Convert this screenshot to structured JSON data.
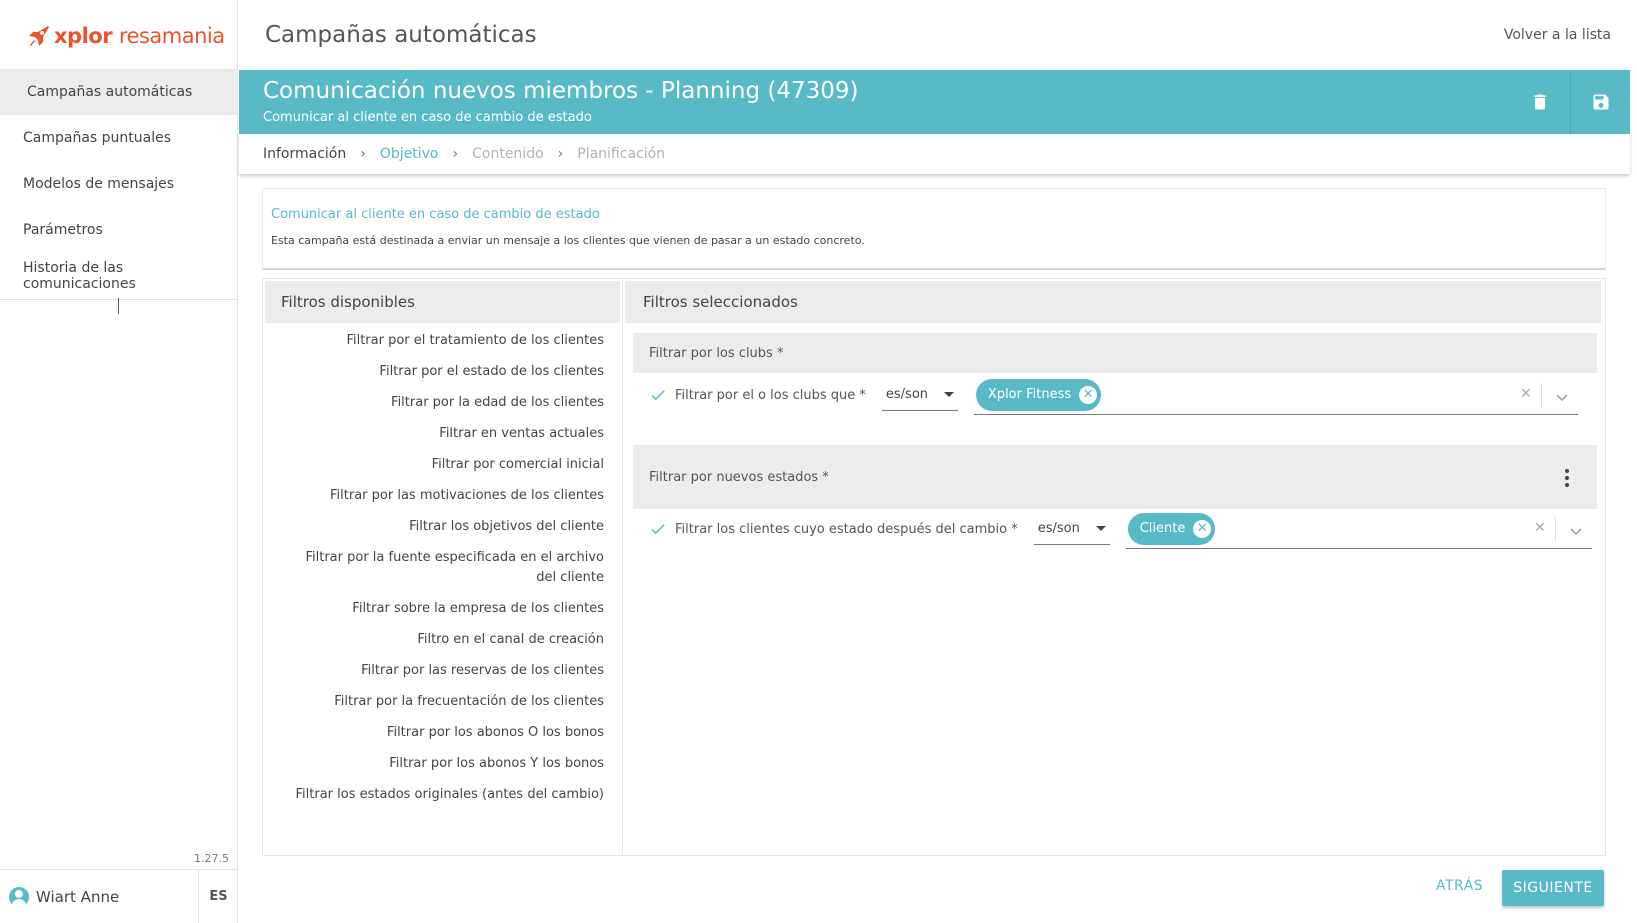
{
  "brand": {
    "name_bold": "xplor",
    "name_thin": "resamania",
    "accent_color": "#58b9c7",
    "brand_color": "#e8542e"
  },
  "sidebar": {
    "items": [
      {
        "label": "Campañas automáticas",
        "active": true
      },
      {
        "label": "Campañas puntuales"
      },
      {
        "label": "Modelos de mensajes"
      },
      {
        "label": "Parámetros"
      },
      {
        "label": "Historia de las comunicaciones"
      }
    ],
    "version": "1.27.5",
    "user_name": "Wiart Anne",
    "language": "ES"
  },
  "header": {
    "title": "Campañas automáticas",
    "back_link": "Volver a la lista"
  },
  "banner": {
    "title": "Comunicación nuevos miembros - Planning (47309)",
    "subtitle": "Comunicar al cliente en caso de cambio de estado",
    "delete_icon": "trash-icon",
    "save_icon": "floppy-icon"
  },
  "steps": [
    {
      "label": "Información",
      "state": "done"
    },
    {
      "label": "Objetivo",
      "state": "current"
    },
    {
      "label": "Contenido",
      "state": "todo"
    },
    {
      "label": "Planificación",
      "state": "todo"
    }
  ],
  "info": {
    "title": "Comunicar al cliente en caso de cambio de estado",
    "description": "Esta campaña está destinada a enviar un mensaje a los clientes que vienen de pasar a un estado concreto."
  },
  "available": {
    "header": "Filtros disponibles",
    "items": [
      "Filtrar por el tratamiento de los clientes",
      "Filtrar por el estado de los clientes",
      "Filtrar por la edad de los clientes",
      "Filtrar en ventas actuales",
      "Filtrar por comercial inicial",
      "Filtrar por las motivaciones de los clientes",
      "Filtrar los objetivos del cliente",
      "Filtrar por la fuente especificada en el archivo del cliente",
      "Filtrar sobre la empresa de los clientes",
      "Filtro en el canal de creación",
      "Filtrar por las reservas de los clientes",
      "Filtrar por la frecuentación de los clientes",
      "Filtrar por los abonos O los bonos",
      "Filtrar por los abonos Y los bonos",
      "Filtrar los estados originales (antes del cambio)"
    ]
  },
  "selected": {
    "header": "Filtros seleccionados",
    "groups": [
      {
        "title": "Filtrar por los clubs *",
        "filter": {
          "label": "Filtrar por el o los clubs que *",
          "operator": "es/son",
          "chip": "Xplor Fitness"
        }
      },
      {
        "title": "Filtrar por nuevos estados *",
        "filter": {
          "label": "Filtrar los clientes cuyo estado después del cambio *",
          "operator": "es/son",
          "chip": "Cliente"
        }
      }
    ]
  },
  "actions": {
    "back": "ATRÁS",
    "next": "SIGUIENTE"
  }
}
